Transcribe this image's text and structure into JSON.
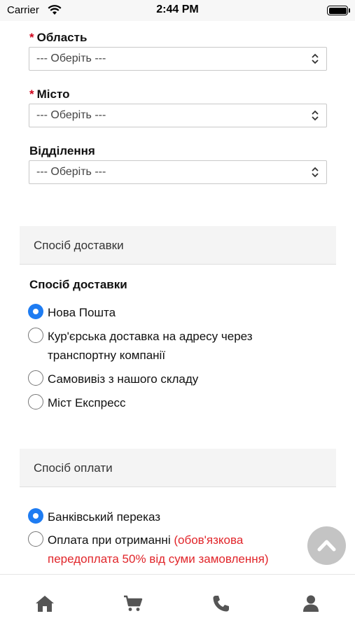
{
  "status_bar": {
    "carrier": "Carrier",
    "time": "2:44 PM"
  },
  "address": {
    "region": {
      "label": "Область",
      "required": true,
      "value": "--- Оберіть ---"
    },
    "city": {
      "label": "Місто",
      "required": true,
      "value": "--- Оберіть ---"
    },
    "branch": {
      "label": "Відділення",
      "required": false,
      "value": "--- Оберіть ---"
    }
  },
  "delivery": {
    "section_title": "Спосіб доставки",
    "group_title": "Спосіб доставки",
    "options": [
      {
        "label": "Нова Пошта",
        "selected": true
      },
      {
        "label": "Кур'єрська доставка на адресу через транспортну компанії",
        "selected": false
      },
      {
        "label": "Самовивіз з нашого складу",
        "selected": false
      },
      {
        "label": "Міст Експресс",
        "selected": false
      }
    ]
  },
  "payment": {
    "section_title": "Спосіб оплати",
    "options": [
      {
        "label": "Банківський переказ",
        "selected": true
      },
      {
        "label": "Оплата при отриманні",
        "note": "(обов'язкова передоплата 50% від суми замовлення)",
        "selected": false
      }
    ]
  },
  "bottom_nav": {
    "items": [
      {
        "icon": "home-icon"
      },
      {
        "icon": "cart-icon"
      },
      {
        "icon": "phone-icon"
      },
      {
        "icon": "user-icon"
      }
    ]
  },
  "colors": {
    "accent": "#1e7cf2",
    "required": "#d0021b",
    "note": "#e1252a",
    "icon": "#555555"
  }
}
